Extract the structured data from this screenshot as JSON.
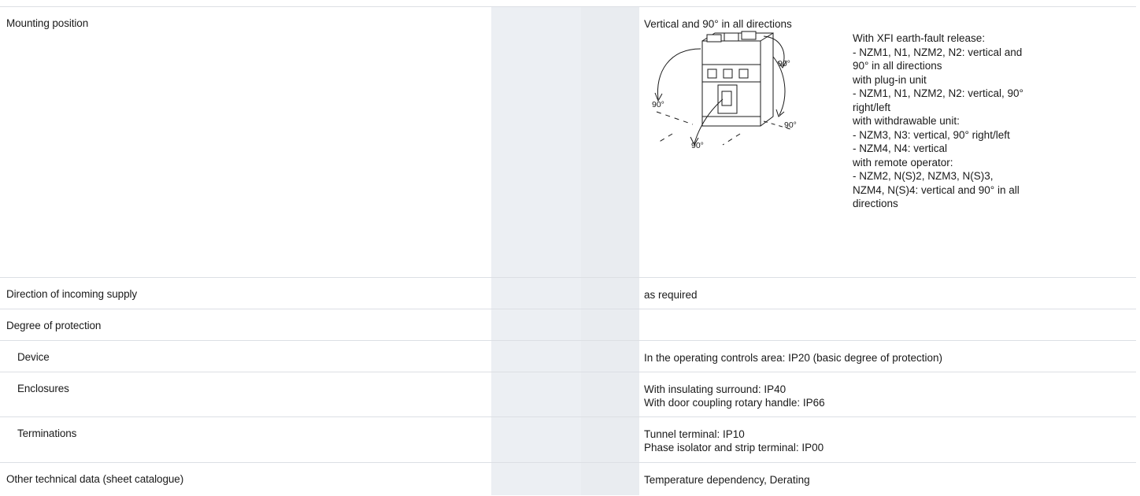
{
  "rows": [
    {
      "label": "Mounting position",
      "value": [
        "Vertical and 90° in all directions"
      ],
      "figure": {
        "icon": "mounting-position-diagram",
        "labels": [
          "90°",
          "90°",
          "90°",
          "90°"
        ]
      },
      "notes": [
        "With XFI earth-fault release:",
        "- NZM1, N1, NZM2, N2: vertical and",
        "90° in all directions",
        "with plug-in unit",
        "- NZM1, N1, NZM2, N2: vertical, 90°",
        "right/left",
        "with withdrawable unit:",
        "- NZM3, N3: vertical, 90° right/left",
        "- NZM4, N4: vertical",
        "with remote operator:",
        "- NZM2, N(S)2, NZM3, N(S)3,",
        "NZM4, N(S)4: vertical and 90° in all",
        "directions"
      ]
    },
    {
      "label": "Direction of incoming supply",
      "value": [
        "as required"
      ]
    },
    {
      "label": "Degree of protection",
      "value": []
    },
    {
      "label": "Device",
      "value": [
        "In the operating controls area: IP20 (basic degree of protection)"
      ]
    },
    {
      "label": "Enclosures",
      "value": [
        "With insulating surround: IP40",
        "With door coupling rotary handle: IP66"
      ]
    },
    {
      "label": "Terminations",
      "value": [
        "Tunnel terminal: IP10",
        "Phase isolator and strip terminal: IP00"
      ]
    },
    {
      "label": "Other technical data (sheet catalogue)",
      "value": [
        "Temperature dependency, Derating"
      ]
    }
  ]
}
